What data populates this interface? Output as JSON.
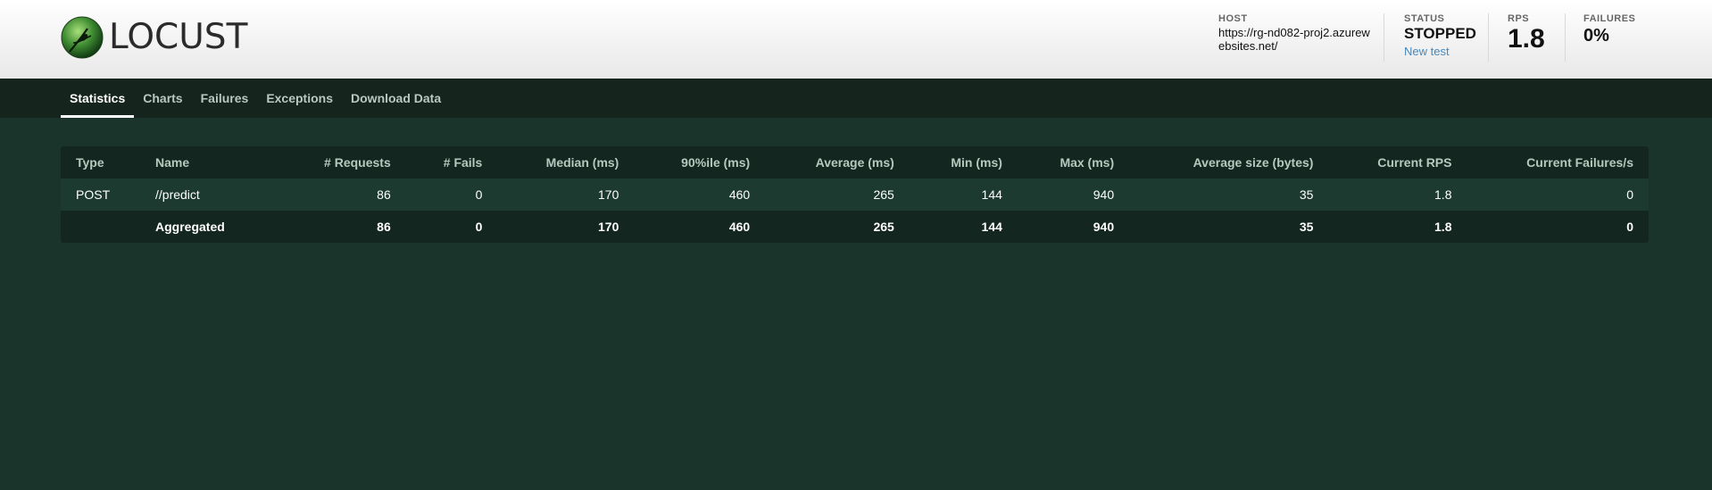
{
  "app": {
    "logo_text": "LOCUST"
  },
  "header": {
    "host_label": "HOST",
    "host_value": "https://rg-nd082-proj2.azurewebsites.net/",
    "status_label": "STATUS",
    "status_value": "STOPPED",
    "new_test_label": "New test",
    "rps_label": "RPS",
    "rps_value": "1.8",
    "failures_label": "FAILURES",
    "failures_value": "0%"
  },
  "nav": {
    "tabs": [
      "Statistics",
      "Charts",
      "Failures",
      "Exceptions",
      "Download Data"
    ],
    "active": "Statistics"
  },
  "table": {
    "columns": [
      "Type",
      "Name",
      "# Requests",
      "# Fails",
      "Median (ms)",
      "90%ile (ms)",
      "Average (ms)",
      "Min (ms)",
      "Max (ms)",
      "Average size (bytes)",
      "Current RPS",
      "Current Failures/s"
    ],
    "rows": [
      [
        "POST",
        "//predict",
        "86",
        "0",
        "170",
        "460",
        "265",
        "144",
        "940",
        "35",
        "1.8",
        "0"
      ]
    ],
    "aggregated": [
      "",
      "Aggregated",
      "86",
      "0",
      "170",
      "460",
      "265",
      "144",
      "940",
      "35",
      "1.8",
      "0"
    ]
  },
  "colors": {
    "background": "#1b342b",
    "nav": "#15251e",
    "table": "#132620",
    "link": "#4a87b8"
  }
}
